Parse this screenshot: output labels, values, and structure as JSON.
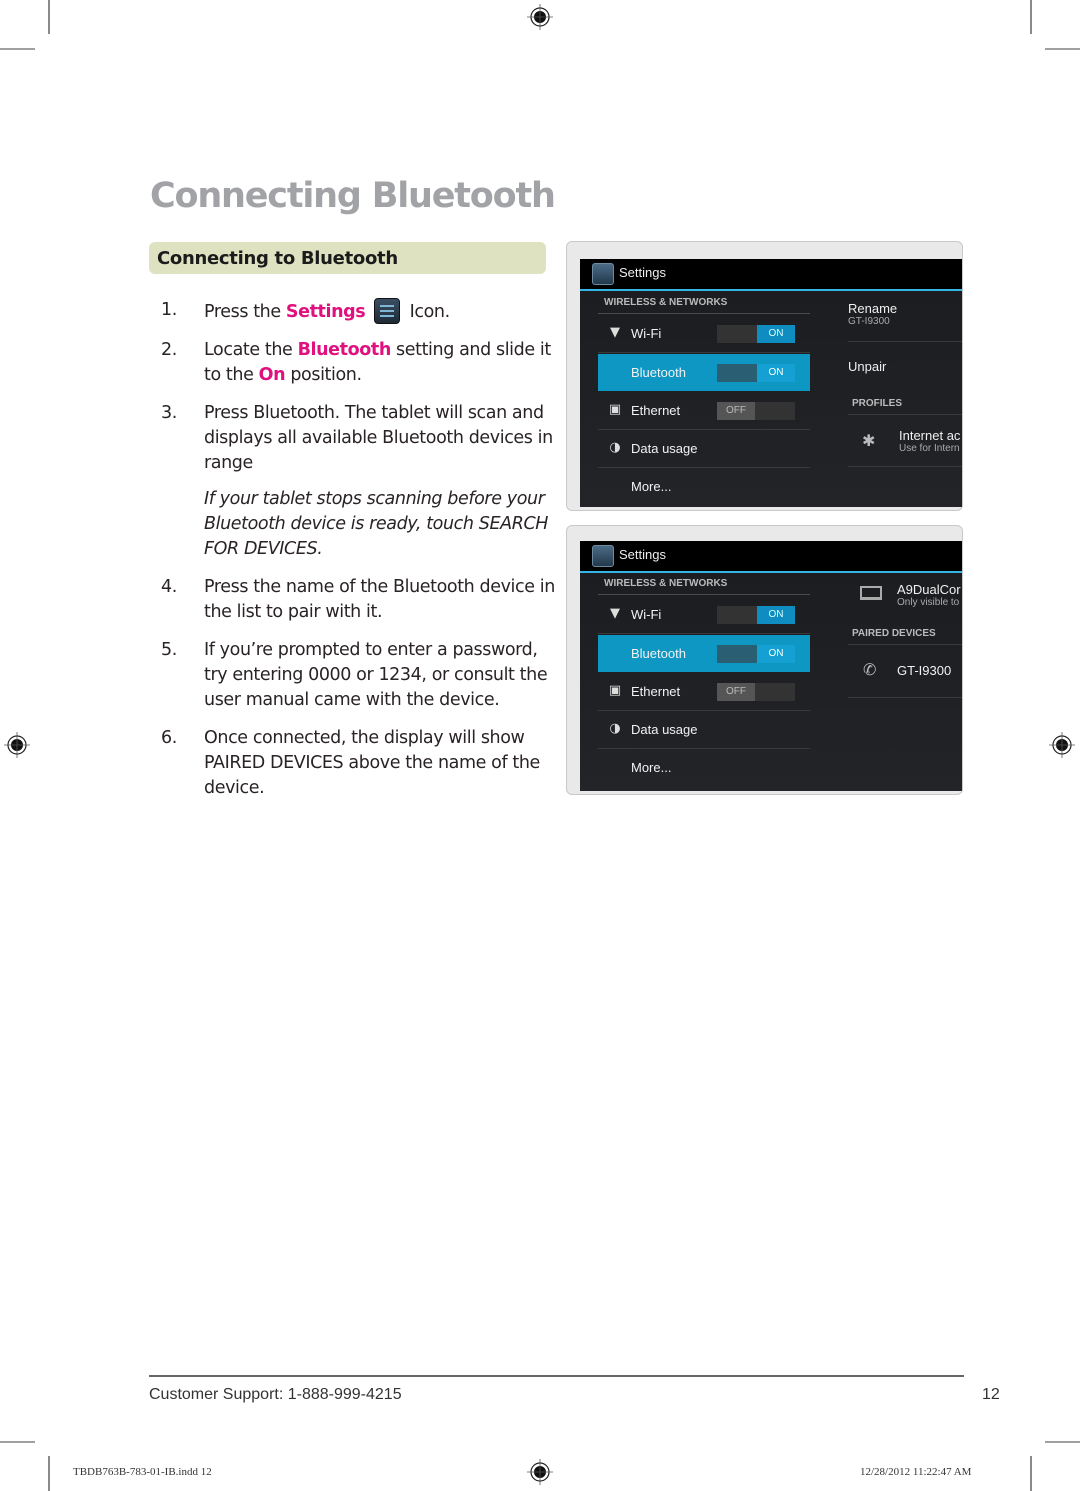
{
  "page": {
    "title": "Connecting Bluetooth",
    "section_heading": "Connecting to Bluetooth",
    "accent_color": "#e0117f",
    "section_bg_color": "#dee2c1"
  },
  "steps": [
    {
      "num": "1.",
      "pre": "Press the ",
      "hl": "Settings",
      "post": " Icon.",
      "icon": "settings-icon"
    },
    {
      "num": "2.",
      "pre": "Locate the ",
      "hl": "Bluetooth",
      "mid": " setting and slide it to the ",
      "hl2": "On",
      "post": " position."
    },
    {
      "num": "3.",
      "text": "Press Bluetooth. The tablet will scan and displays all available Bluetooth devices in range"
    },
    {
      "note": "If your tablet stops scanning before your Bluetooth device is ready, touch SEARCH FOR DEVICES."
    },
    {
      "num": "4.",
      "text": "Press the name of the Bluetooth device in the list to pair with it."
    },
    {
      "num": "5.",
      "text": "If you’re prompted to enter a password, try entering 0000 or 1234, or consult the user manual came with the device."
    },
    {
      "num": "6.",
      "text": "Once connected, the display will show PAIRED DEVICES above the name of the device."
    }
  ],
  "screenshots": [
    {
      "app_title": "Settings",
      "section": "WIRELESS & NETWORKS",
      "items": [
        {
          "label": "Wi-Fi",
          "icon": "wifi-icon",
          "toggle": "ON"
        },
        {
          "label": "Bluetooth",
          "icon": "bluetooth-icon",
          "toggle": "ON",
          "selected": true
        },
        {
          "label": "Ethernet",
          "icon": "ethernet-icon",
          "toggle": "OFF"
        },
        {
          "label": "Data usage",
          "icon": "data-usage-icon"
        },
        {
          "label": "More..."
        }
      ],
      "right_panel": {
        "rename_label": "Rename",
        "rename_sub": "GT-I9300",
        "unpair_label": "Unpair",
        "profiles_header": "PROFILES",
        "profile_title": "Internet ac",
        "profile_sub": "Use for Intern"
      }
    },
    {
      "app_title": "Settings",
      "section": "WIRELESS & NETWORKS",
      "items": [
        {
          "label": "Wi-Fi",
          "icon": "wifi-icon",
          "toggle": "ON"
        },
        {
          "label": "Bluetooth",
          "icon": "bluetooth-icon",
          "toggle": "ON",
          "selected": true
        },
        {
          "label": "Ethernet",
          "icon": "ethernet-icon",
          "toggle": "OFF"
        },
        {
          "label": "Data usage",
          "icon": "data-usage-icon"
        },
        {
          "label": "More..."
        }
      ],
      "right_panel": {
        "device_name": "A9DualCor",
        "device_sub": "Only visible to",
        "paired_header": "PAIRED DEVICES",
        "paired_device": "GT-I9300"
      }
    }
  ],
  "footer": {
    "support": "Customer Support: 1-888-999-4215",
    "page_number": "12"
  },
  "slug": {
    "file": "TBDB763B-783-01-IB.indd   12",
    "timestamp": "12/28/2012   11:22:47 AM"
  }
}
